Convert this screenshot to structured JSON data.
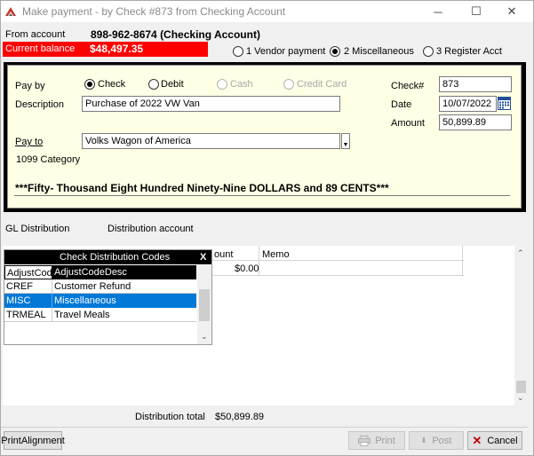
{
  "window": {
    "title": "Make payment - by Check #873 from Checking Account",
    "minimize_glyph": "─",
    "maximize_glyph": "☐",
    "close_glyph": "✕"
  },
  "header": {
    "from_account_label": "From account",
    "from_account_value": "898-962-8674 (Checking Account)",
    "current_balance_label": "Current balance",
    "current_balance_value": "$48,497.35",
    "payment_types": [
      {
        "label": "1 Vendor payment",
        "selected": false
      },
      {
        "label": "2 Miscellaneous",
        "selected": true
      },
      {
        "label": "3 Register Acct",
        "selected": false
      }
    ]
  },
  "form": {
    "pay_by_label": "Pay by",
    "pay_by_options": [
      {
        "label": "Check",
        "selected": true,
        "enabled": true
      },
      {
        "label": "Debit",
        "selected": false,
        "enabled": true
      },
      {
        "label": "Cash",
        "selected": false,
        "enabled": false
      },
      {
        "label": "Credit Card",
        "selected": false,
        "enabled": false
      }
    ],
    "description_label": "Description",
    "description_value": "Purchase of 2022 VW Van",
    "pay_to_label": "Pay to",
    "pay_to_value": "Volks Wagon of America",
    "category_label": "1099 Category",
    "check_no_label": "Check#",
    "check_no_value": "873",
    "date_label": "Date",
    "date_value": "10/07/2022",
    "amount_label": "Amount",
    "amount_value": "50,899.89",
    "amount_words": "***Fifty- Thousand Eight Hundred Ninety-Nine DOLLARS and 89 CENTS***"
  },
  "distribution": {
    "gl_label": "GL Distribution",
    "account_label": "Distribution account",
    "col_amount_header": "ount",
    "col_memo_header": "Memo",
    "row_amount": "$0.00",
    "total_label": "Distribution total",
    "total_value": "$50,899.89"
  },
  "popup": {
    "title": "Check Distribution Codes",
    "close_label": "X",
    "col_code": "AdjustCode",
    "col_desc": "AdjustCodeDesc",
    "rows": [
      {
        "code": "CREF",
        "desc": "Customer Refund",
        "selected": false
      },
      {
        "code": "MISC",
        "desc": "Miscellaneous",
        "selected": true
      },
      {
        "code": "TRMEAL",
        "desc": "Travel Meals",
        "selected": false
      }
    ]
  },
  "footer": {
    "print_alignment_label": "PrintAlignment",
    "print_label": "Print",
    "post_label": "Post",
    "cancel_label": "Cancel"
  },
  "colors": {
    "balance_bar": "#ff0000",
    "panel_fill": "#ffffe6",
    "selected_row": "#0078d7"
  }
}
